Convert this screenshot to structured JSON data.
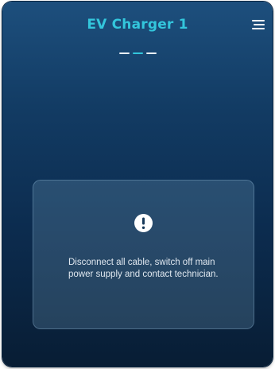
{
  "header": {
    "title": "EV Charger 1",
    "menu_icon": "hamburger-menu-icon"
  },
  "pager": {
    "total": 3,
    "active_index": 1
  },
  "alert": {
    "icon": "exclamation-circle-icon",
    "message": "Disconnect all cable, switch off main power supply and contact technician."
  },
  "colors": {
    "accent": "#33c6dc",
    "background_top": "#1d4f7d",
    "background_bottom": "#081d34",
    "card": "#7ca6c4",
    "text": "#dfe7ef"
  }
}
